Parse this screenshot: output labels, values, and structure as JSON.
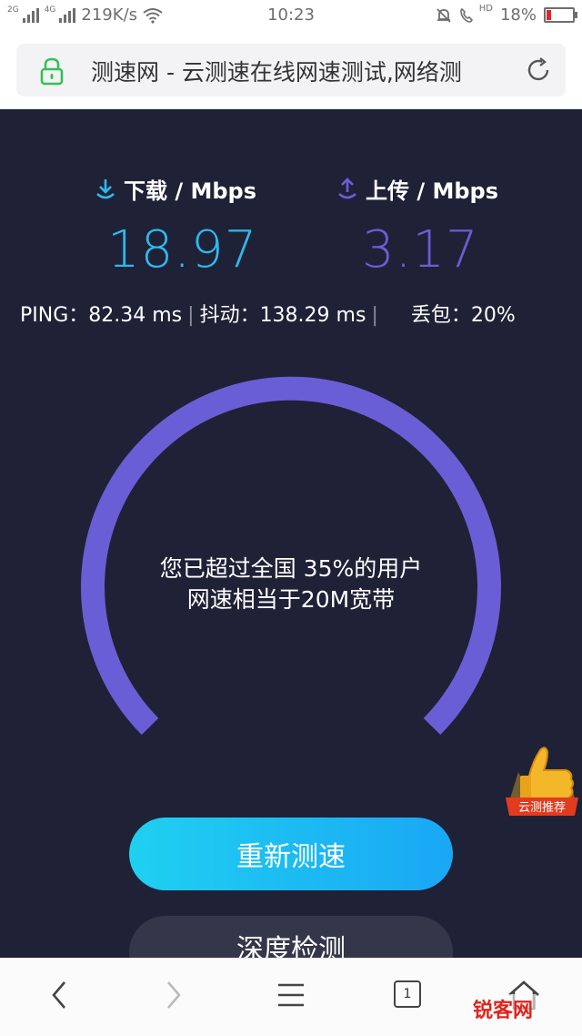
{
  "status_bar": {
    "net1": "2G",
    "net2": "4G",
    "speed": "219K/s",
    "time": "10:23",
    "hd": "HD",
    "battery": "18%",
    "battery_level": 0.18
  },
  "address_bar": {
    "title": "测速网 - 云测速在线网速测试,网络测"
  },
  "download": {
    "label": "下载 / Mbps",
    "value": "18.97"
  },
  "upload": {
    "label": "上传 / Mbps",
    "value": "3.17"
  },
  "metrics": {
    "ping": "PING：82.34 ms",
    "jitter": "抖动：138.29 ms",
    "loss": "丢包：20%"
  },
  "gauge": {
    "line1": "您已超过全国 35%的用户",
    "line2": "网速相当于20M宽带"
  },
  "promo_badge": {
    "label": "云测推荐"
  },
  "buttons": {
    "retest": "重新测速",
    "deep": "深度检测"
  },
  "bottom_nav": {
    "tab_count": "1"
  },
  "watermark": "锐客网",
  "colors": {
    "background": "#1f2136",
    "download": "#2fb9ee",
    "upload": "#6a5ed6",
    "gauge": "#6a5ed6",
    "accent_button": "#1fc0f2"
  }
}
